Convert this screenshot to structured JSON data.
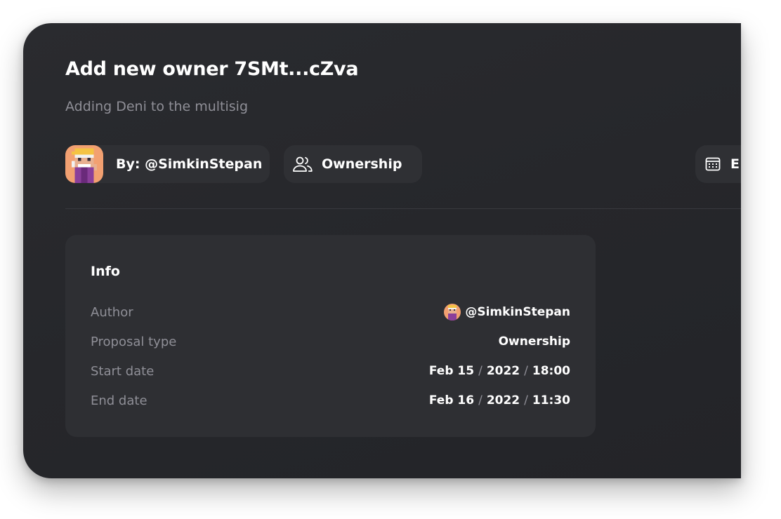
{
  "proposal": {
    "title": "Add new owner 7SMt...cZva",
    "description": "Adding Deni to the multisig"
  },
  "chips": {
    "author_label": "By: @SimkinStepan",
    "type_label": "Ownership",
    "date_label": "E"
  },
  "info": {
    "heading": "Info",
    "author": {
      "key": "Author",
      "value": "@SimkinStepan"
    },
    "proposal_type": {
      "key": "Proposal type",
      "value": "Ownership"
    },
    "start_date": {
      "key": "Start date",
      "day": "Feb 15",
      "year": "2022",
      "time": "18:00"
    },
    "end_date": {
      "key": "End date",
      "day": "Feb 16",
      "year": "2022",
      "time": "11:30"
    },
    "separator": "/"
  },
  "icons": {
    "avatar": "pixel-avatar",
    "type": "users-icon",
    "date": "calendar-icon"
  },
  "colors": {
    "card_bg": "#27282c",
    "chip_bg": "#2f3034",
    "panel_bg": "#2e2f33",
    "muted_text": "#8f8f97",
    "avatar_bg": "#f2a071"
  }
}
